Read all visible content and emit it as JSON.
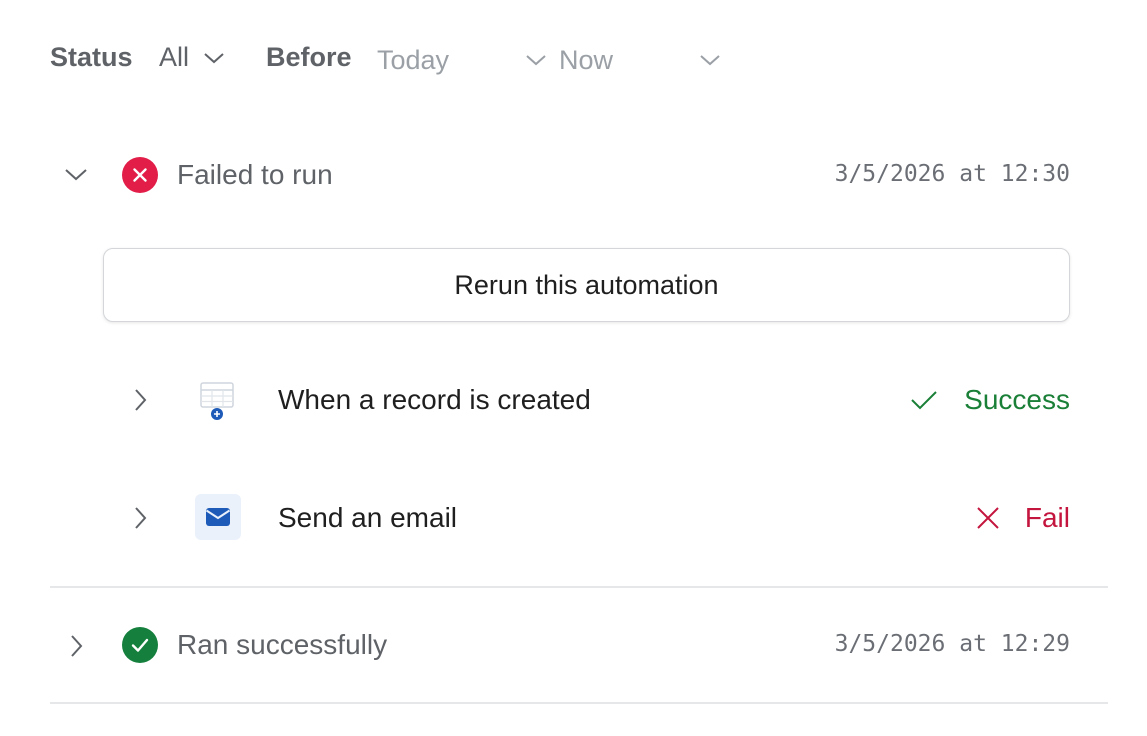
{
  "filters": {
    "status_label": "Status",
    "status_value": "All",
    "before_label": "Before",
    "date_placeholder": "Today",
    "time_placeholder": "Now"
  },
  "runs": [
    {
      "title": "Failed to run",
      "timestamp": "3/5/2026 at 12:30",
      "status": "failed",
      "rerun_label": "Rerun this automation",
      "steps": [
        {
          "title": "When a record is created",
          "status_label": "Success",
          "icon": "table-plus-icon"
        },
        {
          "title": "Send an email",
          "status_label": "Fail",
          "icon": "envelope-icon"
        }
      ]
    },
    {
      "title": "Ran successfully",
      "timestamp": "3/5/2026 at 12:29",
      "status": "success"
    }
  ],
  "colors": {
    "error": "#e11d48",
    "success": "#15803d",
    "success_text": "#1a7f37",
    "fail_text": "#c4153e",
    "muted": "#5f6368"
  }
}
